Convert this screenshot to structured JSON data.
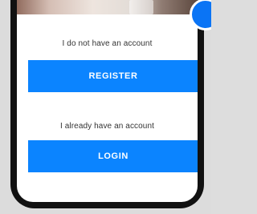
{
  "auth": {
    "register_prompt": "I do not have an account",
    "register_label": "REGISTER",
    "login_prompt": "I already have an account",
    "login_label": "LOGIN"
  },
  "colors": {
    "primary_button": "#0b84ff",
    "button_text": "#ffffff",
    "frame": "#111111",
    "background": "#dcdcdc"
  }
}
